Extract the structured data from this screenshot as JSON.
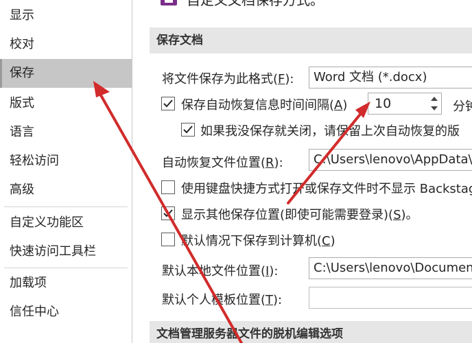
{
  "sidebar": {
    "items": [
      {
        "label": "显示"
      },
      {
        "label": "校对"
      },
      {
        "label": "保存"
      },
      {
        "label": "版式"
      },
      {
        "label": "语言"
      },
      {
        "label": "轻松访问"
      },
      {
        "label": "高级"
      },
      {
        "label": "自定义功能区"
      },
      {
        "label": "快速访问工具栏"
      },
      {
        "label": "加载项"
      },
      {
        "label": "信任中心"
      }
    ],
    "selected": "保存"
  },
  "main": {
    "top_text": "自定义文档保存方式。",
    "section_save": "保存文档",
    "section_offline": "文档管理服务器文件的脱机编辑选项",
    "format": {
      "label_a": "将文件保存为此格式(",
      "label_key": "F",
      "label_b": "):",
      "value": "Word 文档 (*.docx)"
    },
    "autorecover": {
      "label_a": "保存自动恢复信息时间间隔(",
      "label_key": "A",
      "label_b": ")",
      "value": "10",
      "unit": "分钟",
      "checked": true
    },
    "keep_last": {
      "label": "如果我没保存就关闭，请保留上次自动恢复的版",
      "checked": true
    },
    "autorecover_location": {
      "label_a": "自动恢复文件位置(",
      "label_key": "R",
      "label_b": "):",
      "value": "C:\\Users\\lenovo\\AppData\\"
    },
    "no_backstage": {
      "label": "使用键盘快捷方式打开或保存文件时不显示 Backstage",
      "checked": false
    },
    "show_other": {
      "label_a": "显示其他保存位置(即使可能需要登录)(",
      "label_key": "S",
      "label_b": ")。",
      "checked": true
    },
    "save_to_computer": {
      "label_a": "默认情况下保存到计算机(",
      "label_key": "C",
      "label_b": ")",
      "checked": false
    },
    "local_location": {
      "label_a": "默认本地文件位置(",
      "label_key": "I",
      "label_b": "):",
      "value": "C:\\Users\\lenovo\\Documen"
    },
    "template_location": {
      "label_a": "默认个人模板位置(",
      "label_key": "T",
      "label_b": "):",
      "value": ""
    }
  },
  "annotation": {
    "arrow_color": "#d22b2b"
  }
}
